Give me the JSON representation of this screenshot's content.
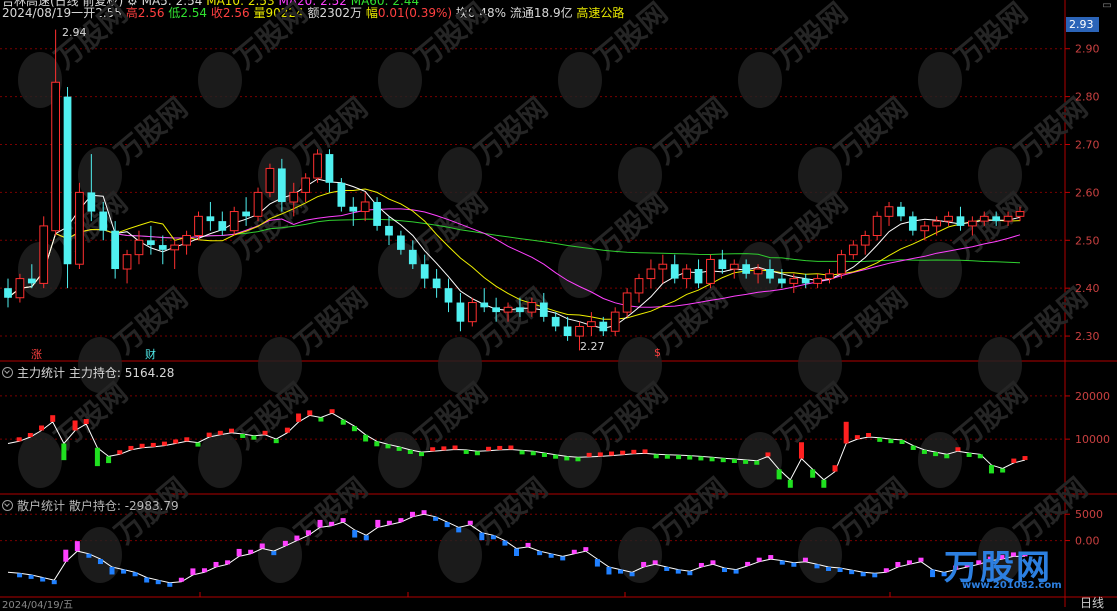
{
  "header": {
    "title": "吉林高速(日线 前复权)",
    "date": "2024/08/19",
    "dash": "一",
    "open_label": "开",
    "open": "2.55",
    "high_label": "高",
    "high": "2.56",
    "low_label": "低",
    "low": "2.54",
    "close_label": "收",
    "close": "2.56",
    "volume_label": "量",
    "volume": "90224",
    "amount_label": "额",
    "amount": "2302万",
    "change_label": "幅",
    "change": "0.01(0.39%)",
    "turnover": "换0.48%",
    "float": "流通18.9亿",
    "sector": "高速公路",
    "ma5": "MA5: 2.54",
    "ma10": "MA10: 2.53",
    "ma20": "MA20: 2.52",
    "ma60": "MA60: 2.44"
  },
  "current_price_tag": "2.93",
  "price_axis": [
    "2.90",
    "2.80",
    "2.70",
    "2.60",
    "2.50",
    "2.40",
    "2.30"
  ],
  "annotations": {
    "high": "2.94",
    "low": "2.27"
  },
  "markers": {
    "zhang": "涨",
    "cai": "财",
    "dollar": "$"
  },
  "indicator1": {
    "name": "主力统计",
    "series_label": "主力持仓:",
    "value": "5164.28",
    "axis": [
      "20000",
      "10000"
    ]
  },
  "indicator2": {
    "name": "散户统计",
    "series_label": "散户持仓:",
    "value": "-2983.79",
    "axis": [
      "5000",
      "0.00"
    ]
  },
  "x_axis": {
    "first_date": "2024/04/19/五",
    "right_label": "日线"
  },
  "watermark": {
    "text": "万股网",
    "url": "www.201082.com"
  },
  "colors": {
    "up": "#ff3030",
    "down": "#50f0f0",
    "ma5": "#ffffff",
    "ma10": "#f0f000",
    "ma20": "#ff40ff",
    "ma60": "#30d030",
    "grid": "#7a0000",
    "pink": "#ff40ff",
    "blue": "#2080ff"
  },
  "chart_data": [
    {
      "type": "candlestick",
      "title": "吉林高速(日线 前复权)",
      "ylim": [
        2.25,
        2.96
      ],
      "series": [
        {
          "name": "K",
          "values": [
            [
              2.4,
              2.42,
              2.36,
              2.38
            ],
            [
              2.38,
              2.43,
              2.37,
              2.42
            ],
            [
              2.42,
              2.45,
              2.4,
              2.41
            ],
            [
              2.41,
              2.55,
              2.4,
              2.53
            ],
            [
              2.52,
              2.94,
              2.51,
              2.83
            ],
            [
              2.8,
              2.82,
              2.4,
              2.45
            ],
            [
              2.45,
              2.62,
              2.44,
              2.6
            ],
            [
              2.6,
              2.68,
              2.54,
              2.56
            ],
            [
              2.56,
              2.58,
              2.5,
              2.52
            ],
            [
              2.52,
              2.54,
              2.42,
              2.44
            ],
            [
              2.44,
              2.48,
              2.41,
              2.47
            ],
            [
              2.47,
              2.52,
              2.45,
              2.5
            ],
            [
              2.5,
              2.53,
              2.47,
              2.49
            ],
            [
              2.49,
              2.51,
              2.45,
              2.48
            ],
            [
              2.48,
              2.5,
              2.44,
              2.49
            ],
            [
              2.49,
              2.52,
              2.47,
              2.51
            ],
            [
              2.51,
              2.56,
              2.5,
              2.55
            ],
            [
              2.55,
              2.58,
              2.52,
              2.54
            ],
            [
              2.54,
              2.56,
              2.51,
              2.52
            ],
            [
              2.52,
              2.57,
              2.51,
              2.56
            ],
            [
              2.56,
              2.59,
              2.53,
              2.55
            ],
            [
              2.55,
              2.61,
              2.54,
              2.6
            ],
            [
              2.6,
              2.66,
              2.59,
              2.65
            ],
            [
              2.65,
              2.67,
              2.56,
              2.58
            ],
            [
              2.58,
              2.62,
              2.55,
              2.6
            ],
            [
              2.6,
              2.64,
              2.58,
              2.63
            ],
            [
              2.63,
              2.69,
              2.62,
              2.68
            ],
            [
              2.68,
              2.69,
              2.6,
              2.62
            ],
            [
              2.62,
              2.63,
              2.56,
              2.57
            ],
            [
              2.57,
              2.59,
              2.53,
              2.56
            ],
            [
              2.56,
              2.6,
              2.54,
              2.58
            ],
            [
              2.58,
              2.59,
              2.52,
              2.53
            ],
            [
              2.53,
              2.55,
              2.49,
              2.51
            ],
            [
              2.51,
              2.52,
              2.47,
              2.48
            ],
            [
              2.48,
              2.5,
              2.44,
              2.45
            ],
            [
              2.45,
              2.47,
              2.4,
              2.42
            ],
            [
              2.42,
              2.44,
              2.38,
              2.4
            ],
            [
              2.4,
              2.42,
              2.35,
              2.37
            ],
            [
              2.37,
              2.39,
              2.31,
              2.33
            ],
            [
              2.33,
              2.38,
              2.32,
              2.37
            ],
            [
              2.37,
              2.4,
              2.35,
              2.36
            ],
            [
              2.36,
              2.38,
              2.33,
              2.35
            ],
            [
              2.35,
              2.37,
              2.33,
              2.36
            ],
            [
              2.36,
              2.38,
              2.34,
              2.35
            ],
            [
              2.35,
              2.38,
              2.34,
              2.37
            ],
            [
              2.37,
              2.39,
              2.33,
              2.34
            ],
            [
              2.34,
              2.35,
              2.31,
              2.32
            ],
            [
              2.32,
              2.34,
              2.29,
              2.3
            ],
            [
              2.3,
              2.33,
              2.27,
              2.32
            ],
            [
              2.32,
              2.35,
              2.3,
              2.33
            ],
            [
              2.33,
              2.34,
              2.3,
              2.31
            ],
            [
              2.31,
              2.36,
              2.3,
              2.35
            ],
            [
              2.35,
              2.4,
              2.34,
              2.39
            ],
            [
              2.39,
              2.43,
              2.37,
              2.42
            ],
            [
              2.42,
              2.46,
              2.4,
              2.44
            ],
            [
              2.44,
              2.47,
              2.41,
              2.45
            ],
            [
              2.45,
              2.47,
              2.41,
              2.42
            ],
            [
              2.42,
              2.45,
              2.4,
              2.44
            ],
            [
              2.44,
              2.46,
              2.4,
              2.41
            ],
            [
              2.41,
              2.47,
              2.4,
              2.46
            ],
            [
              2.46,
              2.48,
              2.43,
              2.44
            ],
            [
              2.44,
              2.46,
              2.42,
              2.45
            ],
            [
              2.45,
              2.46,
              2.42,
              2.43
            ],
            [
              2.43,
              2.45,
              2.41,
              2.44
            ],
            [
              2.44,
              2.46,
              2.41,
              2.42
            ],
            [
              2.42,
              2.44,
              2.4,
              2.41
            ],
            [
              2.41,
              2.43,
              2.39,
              2.42
            ],
            [
              2.42,
              2.43,
              2.4,
              2.41
            ],
            [
              2.41,
              2.43,
              2.4,
              2.42
            ],
            [
              2.42,
              2.44,
              2.41,
              2.43
            ],
            [
              2.43,
              2.48,
              2.42,
              2.47
            ],
            [
              2.47,
              2.5,
              2.46,
              2.49
            ],
            [
              2.49,
              2.52,
              2.47,
              2.51
            ],
            [
              2.51,
              2.56,
              2.5,
              2.55
            ],
            [
              2.55,
              2.58,
              2.53,
              2.57
            ],
            [
              2.57,
              2.58,
              2.54,
              2.55
            ],
            [
              2.55,
              2.56,
              2.51,
              2.52
            ],
            [
              2.52,
              2.54,
              2.5,
              2.53
            ],
            [
              2.53,
              2.55,
              2.51,
              2.54
            ],
            [
              2.54,
              2.56,
              2.53,
              2.55
            ],
            [
              2.55,
              2.57,
              2.52,
              2.53
            ],
            [
              2.53,
              2.55,
              2.51,
              2.54
            ],
            [
              2.54,
              2.56,
              2.53,
              2.55
            ],
            [
              2.55,
              2.56,
              2.53,
              2.54
            ],
            [
              2.54,
              2.56,
              2.53,
              2.55
            ],
            [
              2.55,
              2.57,
              2.54,
              2.56
            ]
          ]
        }
      ]
    },
    {
      "type": "line",
      "title": "主力统计",
      "ylim": [
        -2000,
        26000
      ],
      "series": [
        {
          "name": "主力持仓",
          "values": [
            9000,
            9500,
            10500,
            12000,
            14000,
            9000,
            12000,
            13500,
            8000,
            6000,
            6500,
            7500,
            8000,
            8200,
            8500,
            9000,
            9500,
            9200,
            10500,
            11000,
            11500,
            11200,
            10800,
            11000,
            10000,
            11500,
            14000,
            15500,
            15000,
            16000,
            14500,
            13000,
            11000,
            9500,
            8800,
            8200,
            7500,
            7000,
            7200,
            7400,
            7600,
            7500,
            7200,
            7300,
            7500,
            7600,
            7400,
            7200,
            6800,
            6400,
            6000,
            5800,
            5900,
            6000,
            6200,
            6400,
            6600,
            6700,
            6500,
            6400,
            6300,
            6200,
            6000,
            5800,
            5600,
            5400,
            5200,
            5000,
            6000,
            3000,
            600,
            5500,
            3000,
            600,
            2500,
            9000,
            10000,
            10500,
            10300,
            10000,
            9800,
            8500,
            7500,
            7000,
            6500,
            7200,
            6800,
            6500,
            4000,
            3200,
            4500,
            5164
          ]
        }
      ]
    },
    {
      "type": "line",
      "title": "散户统计",
      "ylim": [
        -10500,
        7500
      ],
      "series": [
        {
          "name": "散户持仓",
          "values": [
            -6000,
            -6200,
            -6500,
            -7000,
            -7500,
            -4000,
            -2000,
            -2500,
            -3500,
            -5000,
            -5500,
            -6000,
            -7000,
            -7500,
            -8000,
            -7800,
            -6500,
            -6000,
            -5000,
            -4500,
            -3000,
            -2500,
            -1500,
            -2000,
            -1000,
            0,
            1000,
            2500,
            2800,
            3500,
            2000,
            1000,
            2500,
            3000,
            3500,
            4500,
            5000,
            4500,
            3500,
            2500,
            3000,
            1500,
            1000,
            0,
            -1500,
            -1200,
            -2000,
            -2500,
            -3000,
            -2500,
            -2000,
            -3500,
            -5000,
            -5500,
            -6000,
            -5000,
            -4500,
            -5000,
            -5500,
            -5800,
            -5000,
            -4500,
            -5200,
            -5500,
            -4800,
            -4000,
            -3500,
            -3800,
            -4200,
            -4000,
            -4500,
            -5000,
            -5200,
            -5600,
            -6000,
            -6200,
            -6000,
            -5000,
            -4500,
            -4000,
            -5500,
            -6000,
            -5500,
            -5000,
            -4500,
            -3800,
            -3500,
            -3000,
            -2983
          ]
        }
      ]
    }
  ]
}
